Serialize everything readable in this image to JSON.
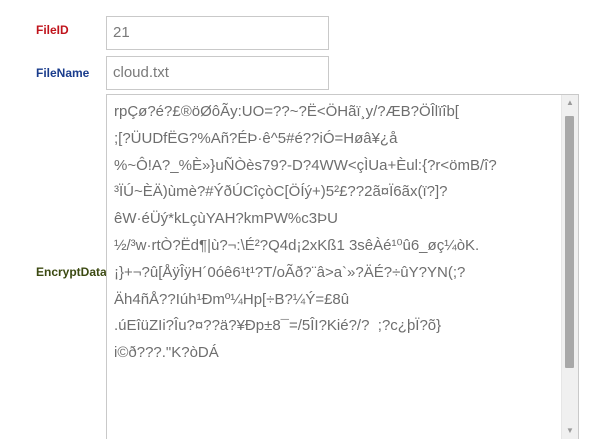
{
  "form": {
    "file_id": {
      "label": "FileID",
      "value": "21"
    },
    "file_name": {
      "label": "FileName",
      "value": "cloud.txt"
    },
    "encrypt_data": {
      "label": "EncryptData",
      "lines": [
        "rpÇø?é?£®öØôÃy:UO=??~?Ë<ÖHãï¸y/?ÆB?ÖÎlïîb[",
        ";[?ÜUDfËG?%Añ?ÉÞ·ê^5#é??iÓ=Høâ¥¿å",
        "%~Ô!A?_%È»}uÑÒès79?-D?4WW<çÌUa+Èul:{?r<ömB/î?",
        "³ÏÚ~ÈÄ)ùmè?#ÝðÚCîçòC[ÖÍý+)5²£??2ã¤Ï6ãx(ï?]?",
        "êW·éÜý*kLçùYAH?kmPW%c3ÞU",
        "½/³w·rtÒ?Ëd¶|ù?¬:\\É²?Q4d¡2xKß1 3sêÀé¹⁰û6_øç¼òK.",
        "¡}+¬?û[ÅÿÎÿH´0óê6¹t¹?T/oÃð?¨â>a`»?ÄÉ?÷ûY?YN(;?",
        "Äh4ñÅ??Iúh¹Ðmº¼Hp[÷B?¼Ý=£8û",
        ".úEîüZIi?Îu?¤??ä?¥Ðp±8¯=/5ÎI?Kié?/?  ;?c¿þÏ?õ}",
        "i©ð???.\"K?òDÁ"
      ]
    }
  },
  "scrollbar": {
    "position_fraction": 0.0
  }
}
